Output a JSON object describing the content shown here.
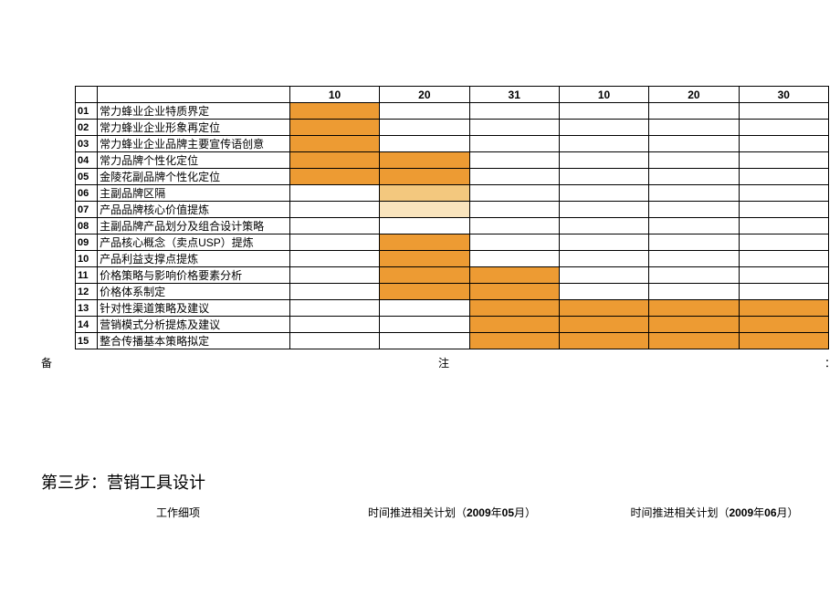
{
  "headers": {
    "c3": "10",
    "c4": "20",
    "c5": "31",
    "c6": "10",
    "c7": "20",
    "c8": "30"
  },
  "rows": [
    {
      "n": "01",
      "task": "常力蜂业企业特质界定",
      "fills": [
        "fill",
        "",
        "",
        "",
        "",
        ""
      ]
    },
    {
      "n": "02",
      "task": "常力蜂业企业形象再定位",
      "fills": [
        "fill",
        "",
        "",
        "",
        "",
        ""
      ]
    },
    {
      "n": "03",
      "task": "常力蜂业企业品牌主要宣传语创意",
      "fills": [
        "fill",
        "",
        "",
        "",
        "",
        ""
      ]
    },
    {
      "n": "04",
      "task": "常力品牌个性化定位",
      "fills": [
        "fill",
        "fill",
        "",
        "",
        "",
        ""
      ]
    },
    {
      "n": "05",
      "task": "金陵花副品牌个性化定位",
      "fills": [
        "fill",
        "fill",
        "",
        "",
        "",
        ""
      ]
    },
    {
      "n": "06",
      "task": "主副品牌区隔",
      "fills": [
        "",
        "lightA",
        "",
        "",
        "",
        ""
      ]
    },
    {
      "n": "07",
      "task": "产品品牌核心价值提炼",
      "fills": [
        "",
        "lightB",
        "",
        "",
        "",
        ""
      ]
    },
    {
      "n": "08",
      "task": "主副品牌产品划分及组合设计策略",
      "fills": [
        "",
        "",
        "",
        "",
        "",
        ""
      ]
    },
    {
      "n": "09",
      "task": "产品核心概念（卖点USP）提炼",
      "fills": [
        "",
        "fill",
        "",
        "",
        "",
        ""
      ]
    },
    {
      "n": "10",
      "task": "产品利益支撑点提炼",
      "fills": [
        "",
        "fill",
        "",
        "",
        "",
        ""
      ]
    },
    {
      "n": "11",
      "task": "价格策略与影响价格要素分析",
      "fills": [
        "",
        "fill",
        "fill",
        "",
        "",
        ""
      ]
    },
    {
      "n": "12",
      "task": "价格体系制定",
      "fills": [
        "",
        "fill",
        "fill",
        "",
        "",
        ""
      ]
    },
    {
      "n": "13",
      "task": "针对性渠道策略及建议",
      "fills": [
        "",
        "",
        "fill",
        "fill",
        "fill",
        "fill"
      ]
    },
    {
      "n": "14",
      "task": "营销模式分析提炼及建议",
      "fills": [
        "",
        "",
        "fill",
        "fill",
        "fill",
        "fill"
      ]
    },
    {
      "n": "15",
      "task": "整合传播基本策略拟定",
      "fills": [
        "",
        "",
        "fill",
        "fill",
        "fill",
        "fill"
      ]
    }
  ],
  "notes": {
    "left": "备",
    "mid": "注",
    "right": "："
  },
  "step_title": "第三步：营销工具设计",
  "sub": {
    "a": "工作细项",
    "b_pre": "时间推进相关计划（",
    "b_bold": "2009",
    "b_mid": "年",
    "b_bold2": "05",
    "b_post": "月）",
    "c_pre": "时间推进相关计划（",
    "c_bold": "2009",
    "c_mid": "年",
    "c_bold2": "06",
    "c_post": "月）"
  }
}
